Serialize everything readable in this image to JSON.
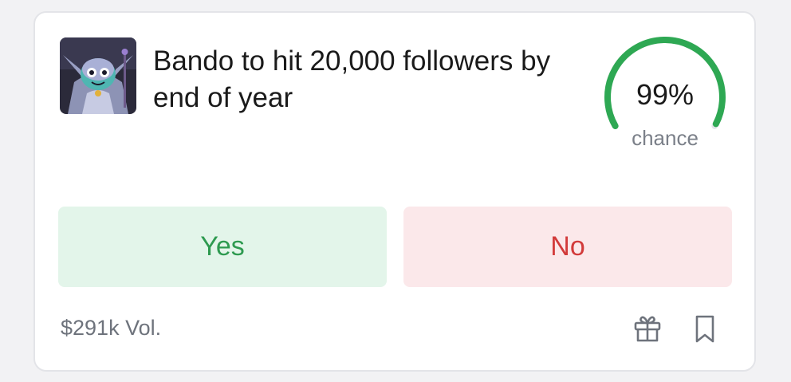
{
  "market": {
    "title": "Bando to hit 20,000 followers by end of year",
    "chance": {
      "value_text": "99%",
      "label": "chance",
      "fraction": 0.99
    },
    "buttons": {
      "yes_label": "Yes",
      "no_label": "No"
    },
    "volume": "$291k Vol.",
    "icons": {
      "avatar": "goblin-avatar",
      "gift": "gift-icon",
      "bookmark": "bookmark-icon"
    }
  },
  "colors": {
    "yes_bg": "#e3f5ea",
    "yes_text": "#2e9a50",
    "no_bg": "#fbe8ea",
    "no_text": "#d23a3a",
    "gauge_fill": "#2ea853",
    "gauge_track": "#e4e6ea"
  }
}
